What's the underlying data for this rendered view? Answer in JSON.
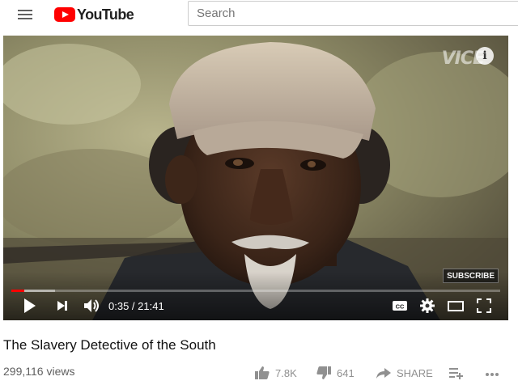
{
  "header": {
    "logo_text": "YouTube",
    "search_placeholder": "Search"
  },
  "player": {
    "watermark": "VICE",
    "info_glyph": "i",
    "subscribe_label": "SUBSCRIBE",
    "current_time": "0:35",
    "duration": "21:41",
    "time_display": "0:35 / 21:41",
    "played_fraction": 0.027,
    "buffered_fraction": 0.09
  },
  "video": {
    "title": "The Slavery Detective of the South",
    "views": "299,116 views"
  },
  "actions": {
    "like_count": "7.8K",
    "dislike_count": "641",
    "share_label": "SHARE"
  },
  "icons": {
    "menu": "hamburger-menu-icon",
    "play": "play-icon",
    "next": "skip-next-icon",
    "volume": "volume-icon",
    "captions": "closed-captions-icon",
    "settings": "gear-icon",
    "theater": "theater-mode-icon",
    "fullscreen": "fullscreen-icon",
    "like": "thumbs-up-icon",
    "dislike": "thumbs-down-icon",
    "share": "share-icon",
    "save": "add-to-playlist-icon",
    "more": "more-icon"
  },
  "colors": {
    "brand_red": "#ff0000",
    "progress_played": "#ff0000"
  }
}
